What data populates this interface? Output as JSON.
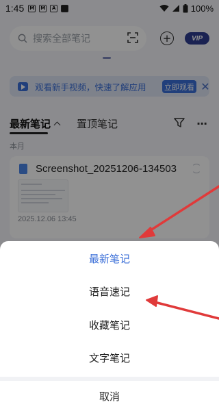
{
  "status_bar": {
    "time": "1:45",
    "icons": [
      "notification-m-icon",
      "notification-m-icon",
      "notification-a-icon",
      "notification-square-icon"
    ],
    "battery": "100%"
  },
  "search": {
    "placeholder": "搜索全部笔记"
  },
  "header": {
    "vip_label": "VIP"
  },
  "banner": {
    "text": "观看新手视频，快速了解应用",
    "button": "立即观看"
  },
  "tabs": {
    "latest": "最新笔记",
    "pinned": "置顶笔记"
  },
  "section": {
    "month": "本月"
  },
  "note": {
    "title": "Screenshot_20251206-134503",
    "date": "2025.12.06 13:45"
  },
  "action_sheet": {
    "options": [
      "最新笔记",
      "语音速记",
      "收藏笔记",
      "文字笔记"
    ],
    "active_index": 0,
    "cancel": "取消"
  },
  "colors": {
    "accent": "#3b6fd8",
    "vip": "#2e3d91",
    "annotation": "#e03a3a"
  }
}
